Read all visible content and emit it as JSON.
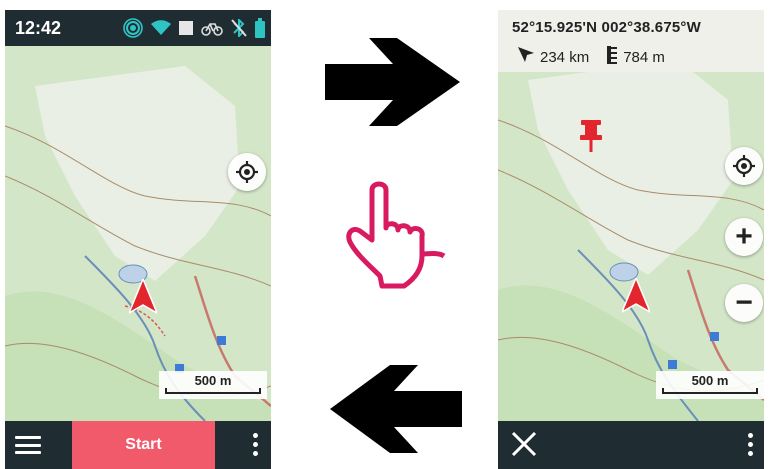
{
  "left_screen": {
    "status": {
      "time": "12:42"
    },
    "scale_label": "500 m",
    "start_label": "Start"
  },
  "right_screen": {
    "coordinates": "52°15.925'N 002°38.675°W",
    "distance": "234 km",
    "elevation": "784 m",
    "zoom_in_label": "+",
    "zoom_out_label": "−",
    "scale_label": "500 m"
  },
  "icons": {
    "status": [
      "hotspot-icon",
      "wifi-icon",
      "battery-saver-icon",
      "bike-icon",
      "bluetooth-off-icon",
      "battery-icon"
    ],
    "close": "close-icon"
  },
  "colors": {
    "bar": "#1f2d33",
    "start": "#f05a6b",
    "accent": "#2ec4c4",
    "marker": "#e3262d",
    "hand": "#d81b60"
  }
}
